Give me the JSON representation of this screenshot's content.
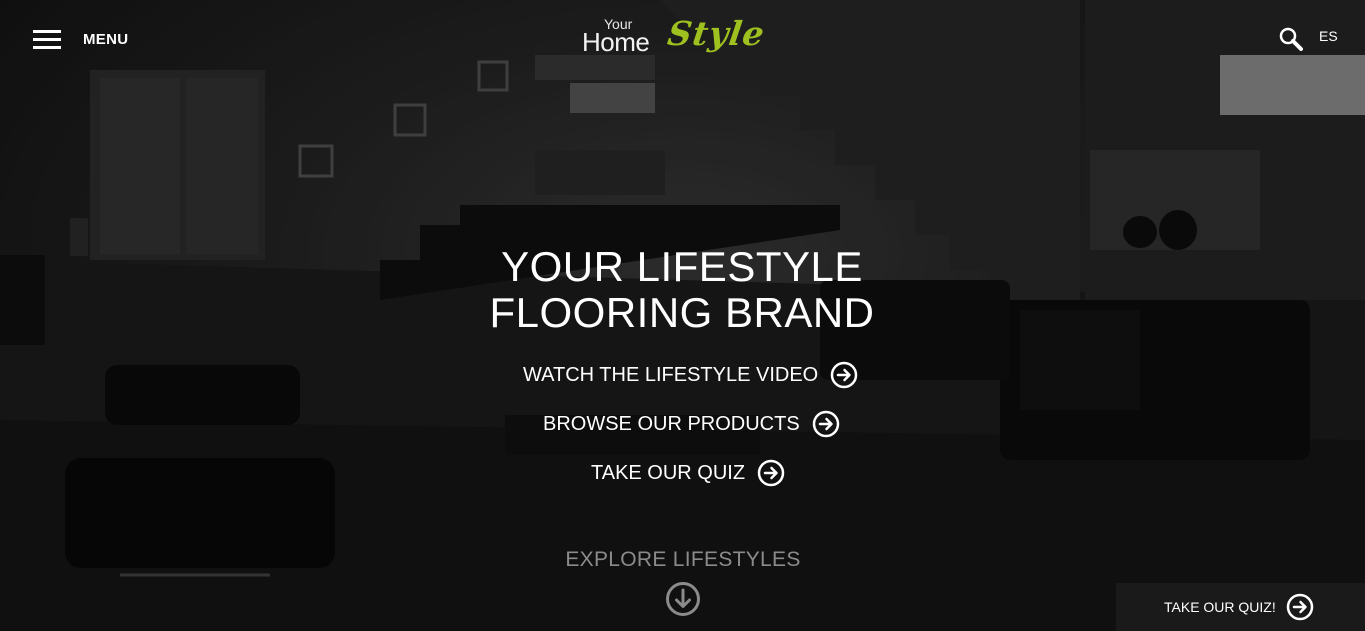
{
  "header": {
    "menu_label": "MENU",
    "logo": {
      "your": "Your",
      "home": "Home",
      "style": "Style"
    },
    "language": "ES"
  },
  "hero": {
    "headline_line1": "YOUR LIFESTYLE",
    "headline_line2": "FLOORING BRAND",
    "links": [
      {
        "label": "WATCH THE LIFESTYLE VIDEO"
      },
      {
        "label": "BROWSE OUR PRODUCTS"
      },
      {
        "label": "TAKE OUR QUIZ"
      }
    ],
    "explore_label": "EXPLORE LIFESTYLES"
  },
  "quiz_bar": {
    "label": "TAKE OUR QUIZ!"
  },
  "colors": {
    "accent": "#9fc11f",
    "text": "#ffffff",
    "muted": "#8b8b8b"
  },
  "icons": [
    "hamburger-icon",
    "search-icon",
    "arrow-right-circle-icon",
    "arrow-down-circle-icon"
  ]
}
